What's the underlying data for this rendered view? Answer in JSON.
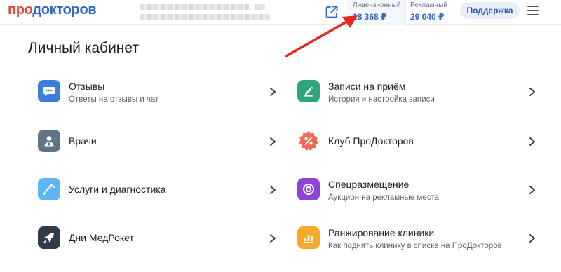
{
  "header": {
    "logo_pro": "про",
    "logo_rest": "докторов",
    "license": {
      "label": "Лицензионный",
      "value": "18 368 ₽"
    },
    "advertising": {
      "label": "Рекламный",
      "value": "29 040 ₽"
    },
    "support_label": "Поддержка"
  },
  "main": {
    "title": "Личный кабинет",
    "tiles": [
      {
        "title": "Отзывы",
        "subtitle": "Ответы на отзывы и чат",
        "icon": "chat-icon",
        "color": "#3b7ddd"
      },
      {
        "title": "Записи на приём",
        "subtitle": "История и настройка записи",
        "icon": "pencil-icon",
        "color": "#2fa57a"
      },
      {
        "title": "Врачи",
        "subtitle": "",
        "icon": "doctor-icon",
        "color": "#5f7389"
      },
      {
        "title": "Клуб ПроДокторов",
        "subtitle": "",
        "icon": "percent-badge-icon",
        "color": "#f06b55"
      },
      {
        "title": "Услуги и диагностика",
        "subtitle": "",
        "icon": "syringe-icon",
        "color": "#5cb6f2"
      },
      {
        "title": "Спецразмещение",
        "subtitle": "Аукцион на рекламные места",
        "icon": "target-icon",
        "color": "#8e44d8"
      },
      {
        "title": "Дни МедРокет",
        "subtitle": "",
        "icon": "rocket-icon",
        "color": "#2f3a4a"
      },
      {
        "title": "Ранжирование клиники",
        "subtitle": "Как поднять клинику в списке на ПроДокторов",
        "icon": "bar-chart-icon",
        "color": "#f7a928"
      }
    ]
  },
  "colors": {
    "brand_red": "#e8443a",
    "brand_blue": "#2e67c6",
    "annotation_arrow": "#e6261f"
  }
}
